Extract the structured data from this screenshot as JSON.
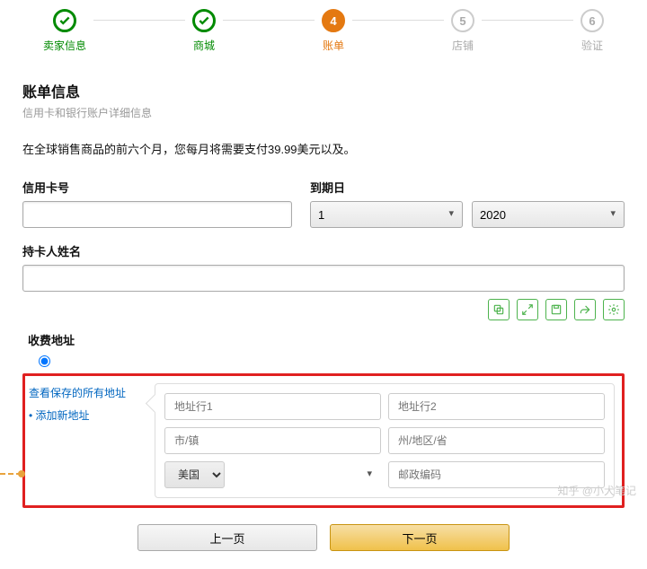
{
  "stepper": {
    "steps": [
      {
        "label": "卖家信息",
        "state": "done"
      },
      {
        "label": "商城",
        "state": "done"
      },
      {
        "label": "账单",
        "state": "active",
        "num": "4"
      },
      {
        "label": "店铺",
        "state": "pending",
        "num": "5"
      },
      {
        "label": "验证",
        "state": "pending",
        "num": "6"
      }
    ]
  },
  "section": {
    "title": "账单信息",
    "subtitle": "信用卡和银行账户详细信息"
  },
  "notice": "在全球销售商品的前六个月，您每月将需要支付39.99美元以及。",
  "form": {
    "card_number_label": "信用卡号",
    "card_number_value": "",
    "expiry_label": "到期日",
    "expiry_month": "1",
    "expiry_year": "2020",
    "holder_label": "持卡人姓名",
    "holder_value": ""
  },
  "billing": {
    "title": "收费地址",
    "view_all": "查看保存的所有地址",
    "add_new": "添加新地址",
    "addr1_placeholder": "地址行1",
    "addr2_placeholder": "地址行2",
    "city_placeholder": "市/镇",
    "region_placeholder": "州/地区/省",
    "country_value": "美国",
    "postal_placeholder": "邮政编码"
  },
  "nav": {
    "prev": "上一页",
    "next": "下一页"
  },
  "watermark": "知乎 @小犬笔记"
}
